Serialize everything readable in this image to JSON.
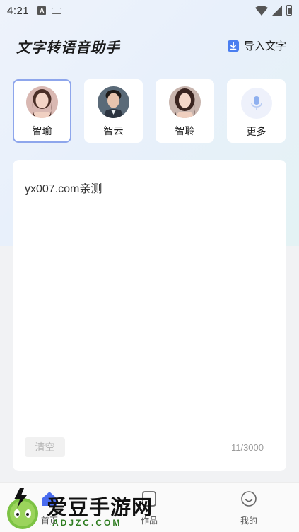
{
  "status_bar": {
    "time": "4:21",
    "input_indicator": "A",
    "icons": [
      "input-method-icon",
      "keyboard-icon",
      "wifi-icon",
      "signal-icon",
      "battery-icon"
    ]
  },
  "header": {
    "title": "文字转语音助手",
    "import_label": "导入文字",
    "import_icon": "download-file-icon"
  },
  "voices": [
    {
      "name": "智瑜",
      "selected": true
    },
    {
      "name": "智云",
      "selected": false
    },
    {
      "name": "智聆",
      "selected": false
    },
    {
      "name": "更多",
      "selected": false,
      "icon": "microphone-icon"
    }
  ],
  "editor": {
    "text": "yx007.com亲测",
    "clear_label": "清空",
    "char_count": "11/3000"
  },
  "bottom_nav": [
    {
      "label": "首页",
      "icon": "home-icon",
      "active": true
    },
    {
      "label": "作品",
      "icon": "works-icon",
      "active": false
    },
    {
      "label": "我的",
      "icon": "profile-icon",
      "active": false
    }
  ],
  "watermark": {
    "title": "爱豆手游网",
    "domain": "ADJZC.COM"
  },
  "colors": {
    "accent": "#4a6cf0",
    "selected_border": "#8ea6ec",
    "watermark_green": "#2e7d20"
  }
}
